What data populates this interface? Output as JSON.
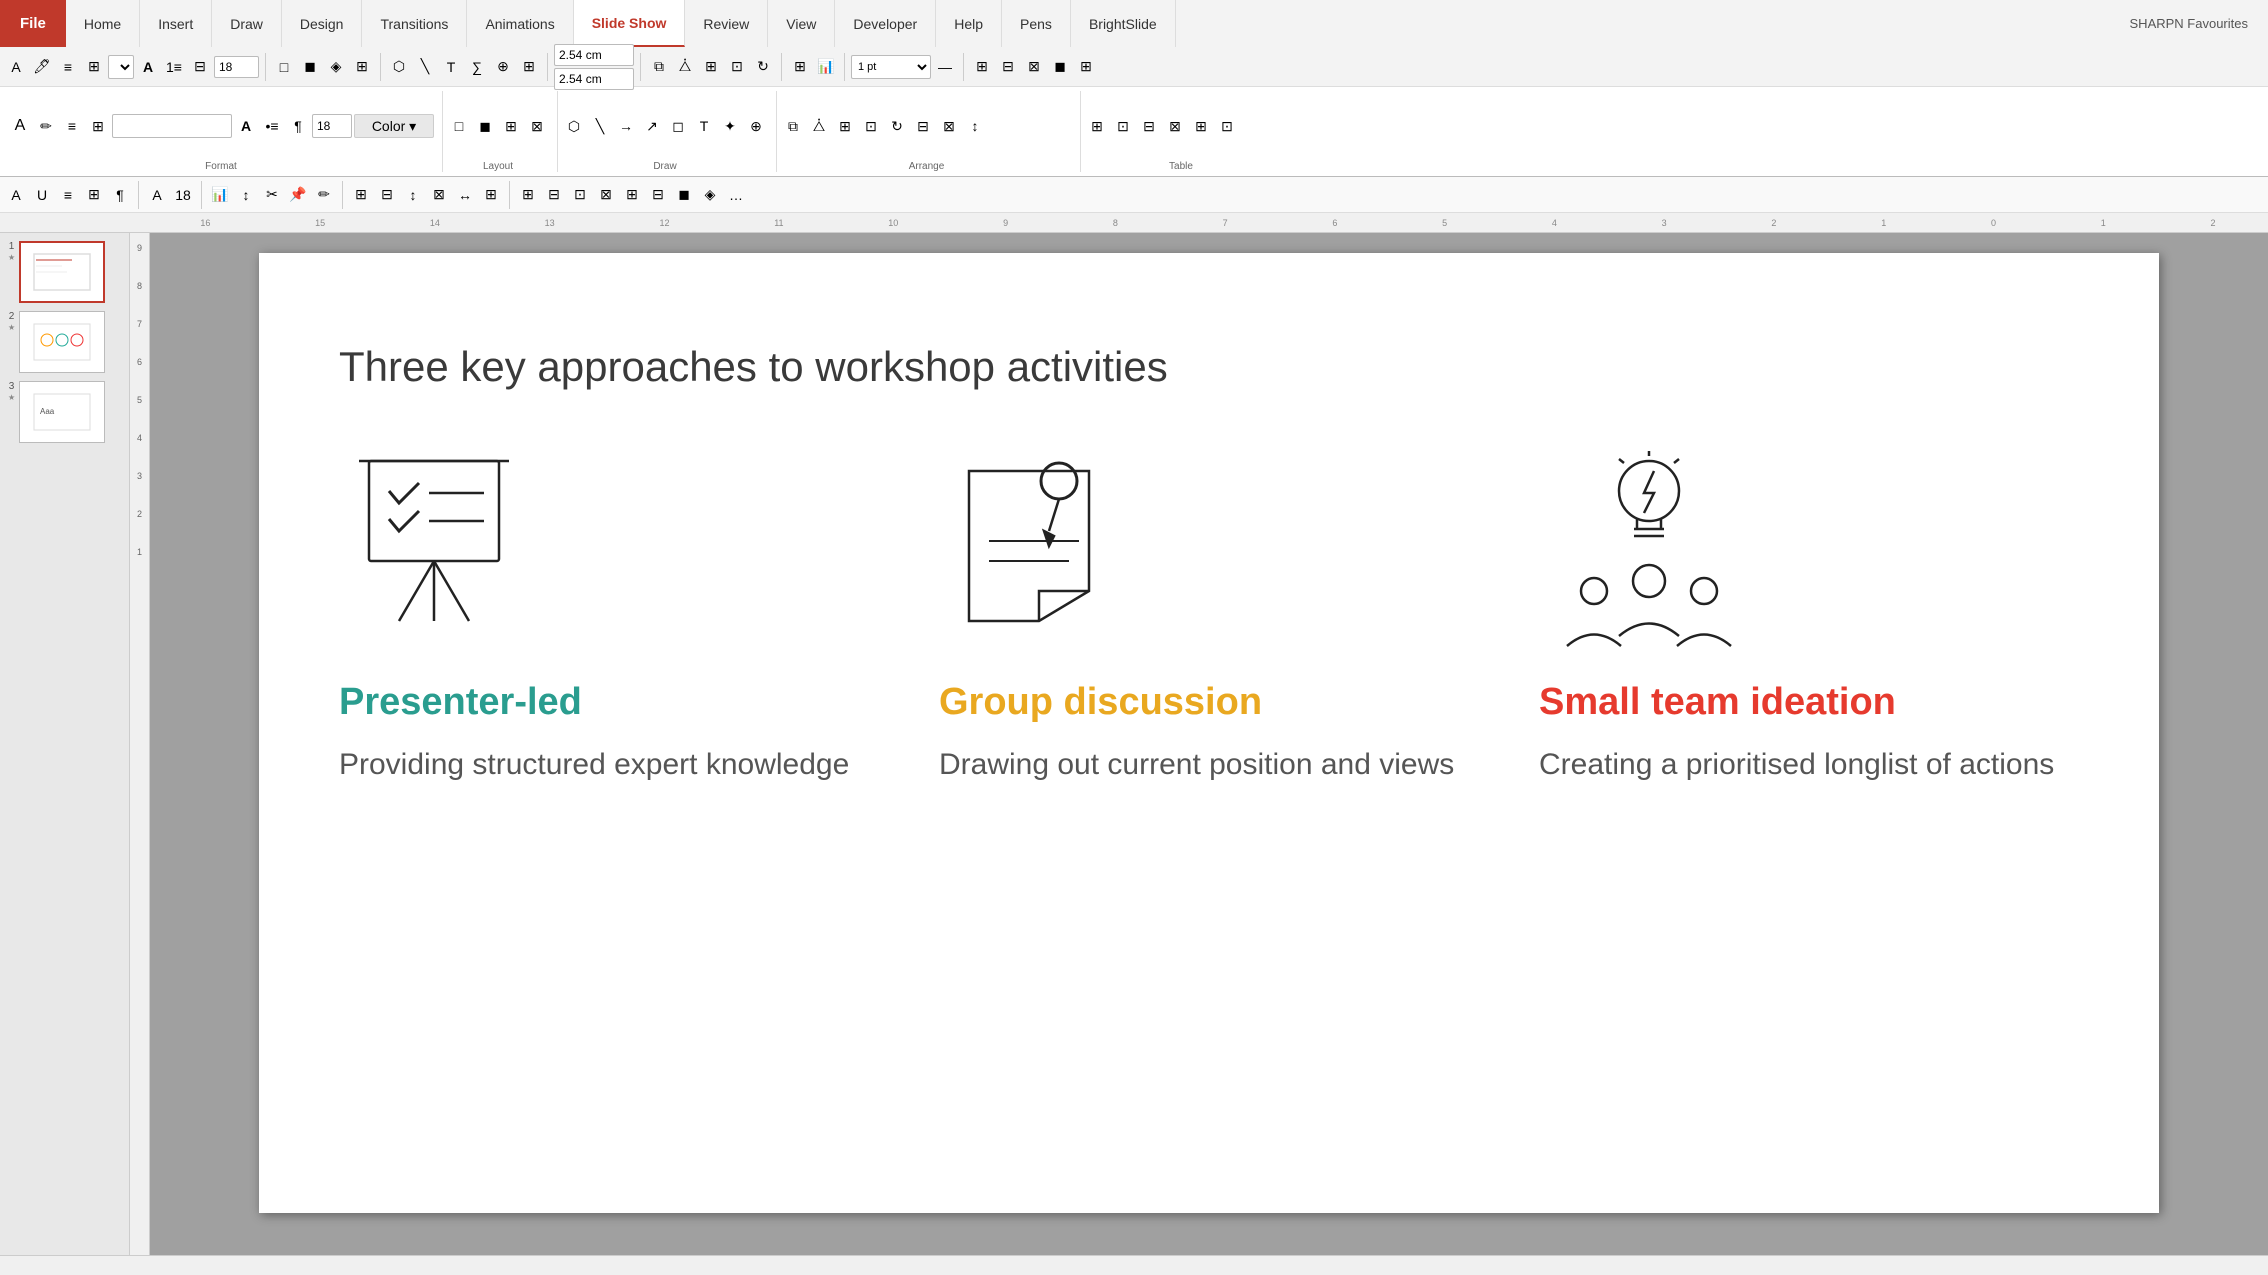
{
  "titlebar": {
    "file_label": "File",
    "app_name": "SHARPN Favourites",
    "tabs": [
      "Home",
      "Insert",
      "Draw",
      "Design",
      "Transitions",
      "Animations",
      "Slide Show",
      "Review",
      "View",
      "Developer",
      "Help",
      "Pens",
      "BrightSlide"
    ],
    "active_tab": "Slide Show"
  },
  "ribbon": {
    "groups": [
      {
        "label": "Format",
        "items": [
          "font",
          "size",
          "bold",
          "italic",
          "underline"
        ]
      },
      {
        "label": "Layout",
        "items": [
          "layout"
        ]
      },
      {
        "label": "Draw",
        "items": [
          "draw"
        ]
      },
      {
        "label": "Arrange",
        "items": [
          "arrange"
        ]
      },
      {
        "label": "Table",
        "items": [
          "table"
        ]
      }
    ],
    "font_size": "18",
    "height_val": "2.54 cm",
    "width_val": "2.54 cm",
    "line_weight": "1 pt"
  },
  "slides": [
    {
      "num": "1",
      "star": "★",
      "active": true
    },
    {
      "num": "2",
      "star": "★"
    },
    {
      "num": "3",
      "star": "★"
    }
  ],
  "ruler": {
    "h_marks": [
      "16",
      "15",
      "14",
      "13",
      "12",
      "11",
      "10",
      "9",
      "8",
      "7",
      "6",
      "5",
      "4",
      "3",
      "2",
      "1",
      "0",
      "1",
      "2"
    ],
    "v_marks": [
      "9",
      "8",
      "7",
      "6",
      "5",
      "4",
      "3",
      "2",
      "1"
    ]
  },
  "slide": {
    "title": "Three key approaches to workshop activities",
    "approaches": [
      {
        "id": "presenter-led",
        "title": "Presenter-led",
        "title_class": "teal",
        "description": "Providing structured expert knowledge",
        "icon_type": "presentation-board"
      },
      {
        "id": "group-discussion",
        "title": "Group discussion",
        "title_class": "amber",
        "description": "Drawing out current position and views",
        "icon_type": "sticky-note-pin"
      },
      {
        "id": "small-team-ideation",
        "title": "Small team ideation",
        "title_class": "red",
        "description": "Creating a prioritised longlist of actions",
        "icon_type": "team-lightbulb"
      }
    ]
  }
}
